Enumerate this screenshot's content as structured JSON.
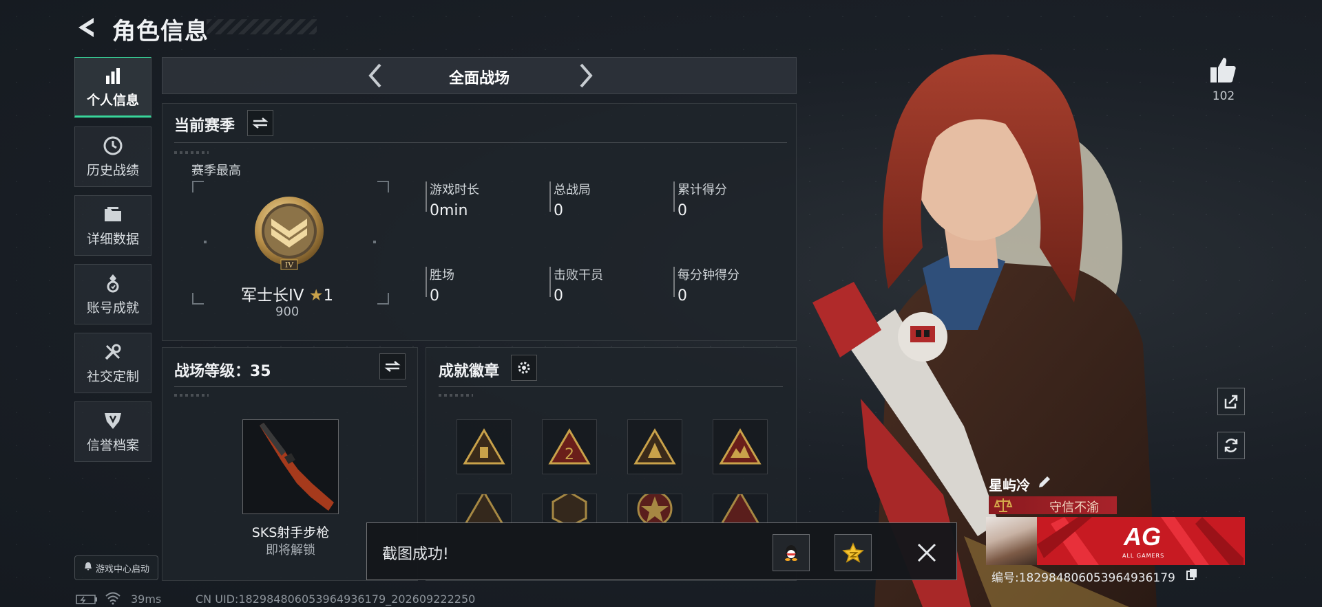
{
  "header": {
    "title": "角色信息"
  },
  "nav": {
    "items": [
      {
        "label": "个人信息",
        "icon": "bar-chart-icon",
        "active": true
      },
      {
        "label": "历史战绩",
        "icon": "clock-icon",
        "active": false
      },
      {
        "label": "详细数据",
        "icon": "folder-icon",
        "active": false
      },
      {
        "label": "账号成就",
        "icon": "medal-icon",
        "active": false
      },
      {
        "label": "社交定制",
        "icon": "wrench-icon",
        "active": false
      },
      {
        "label": "信誉档案",
        "icon": "shield-icon",
        "active": false
      }
    ],
    "game_center": "游戏中心启动"
  },
  "mode": {
    "label": "全面战场"
  },
  "season": {
    "title": "当前赛季",
    "best_label": "赛季最高",
    "rank_name": "军士长IV",
    "rank_stars": "1",
    "rank_score": "900",
    "rank_numeral": "IV",
    "stats": [
      {
        "label": "游戏时长",
        "value": "0min"
      },
      {
        "label": "总战局",
        "value": "0"
      },
      {
        "label": "累计得分",
        "value": "0"
      },
      {
        "label": "胜场",
        "value": "0"
      },
      {
        "label": "击败干员",
        "value": "0"
      },
      {
        "label": "每分钟得分",
        "value": "0"
      }
    ]
  },
  "level": {
    "title": "战场等级：35",
    "weapon_name": "SKS射手步枪",
    "weapon_status": "即将解锁"
  },
  "badges": {
    "title": "成就徽章"
  },
  "profile": {
    "like_count": "102",
    "player_name": "星屿冷",
    "title_badge": "守信不渝",
    "team_banner_text": "AG",
    "team_banner_sub": "ALL GAMERS",
    "player_id": "编号:18298480605396493617​9"
  },
  "toast": {
    "message": "截图成功!"
  },
  "status": {
    "ping": "39ms",
    "uid": "CN UID:182984806053964936179_202609222250"
  },
  "colors": {
    "accent": "#38d59a",
    "gold": "#c9a24a",
    "team_red": "#c71a22"
  }
}
